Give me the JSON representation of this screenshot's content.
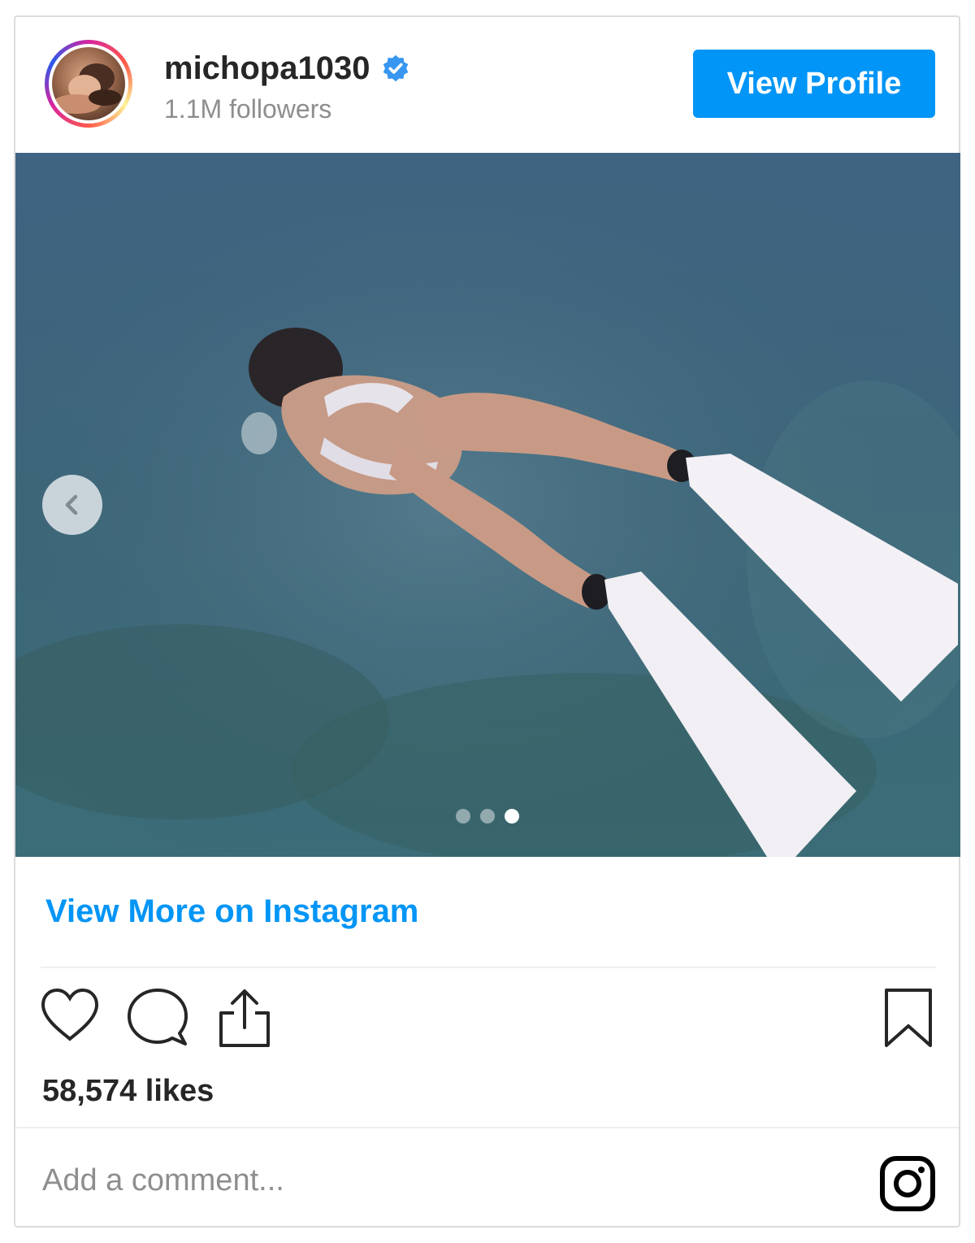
{
  "header": {
    "username": "michopa1030",
    "followers": "1.1M followers",
    "view_profile_label": "View Profile"
  },
  "post": {
    "carousel": {
      "total": 3,
      "active_index": 3
    },
    "view_more_label": "View More on Instagram",
    "likes": "58,574 likes",
    "comment_placeholder": "Add a comment..."
  },
  "icons": {
    "verified": "verified-badge-icon",
    "prev": "chevron-left-icon",
    "like": "heart-icon",
    "comment": "comment-bubble-icon",
    "share": "share-icon",
    "save": "bookmark-icon",
    "brand": "instagram-logo-icon"
  },
  "colors": {
    "accent": "#0095f6",
    "text": "#262626",
    "muted": "#8e8e8e",
    "border": "#dbdbdb"
  }
}
